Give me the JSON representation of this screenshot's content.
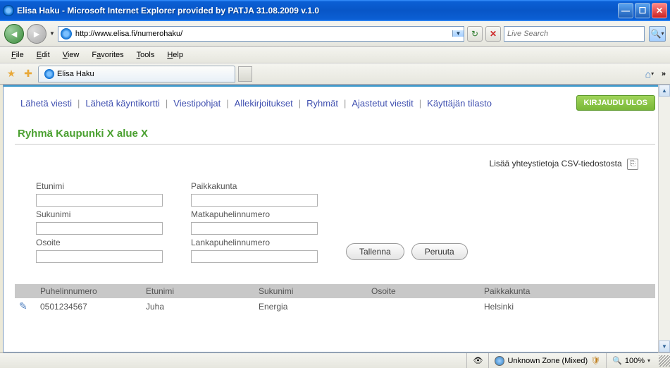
{
  "window": {
    "title": "Elisa Haku - Microsoft Internet Explorer provided by PATJA 31.08.2009 v.1.0"
  },
  "addressbar": {
    "url": "http://www.elisa.fi/numerohaku/"
  },
  "search": {
    "placeholder": "Live Search"
  },
  "menu": {
    "file": "File",
    "edit": "Edit",
    "view": "View",
    "favorites": "Favorites",
    "tools": "Tools",
    "help": "Help"
  },
  "tab": {
    "title": "Elisa Haku"
  },
  "appnav": {
    "items": [
      "Lähetä viesti",
      "Lähetä käyntikortti",
      "Viestipohjat",
      "Allekirjoitukset",
      "Ryhmät",
      "Ajastetut viestit",
      "Käyttäjän tilasto"
    ],
    "logout": "KIRJAUDU ULOS"
  },
  "page": {
    "title": "Ryhmä Kaupunki X alue X",
    "csv_link": "Lisää yhteystietoja CSV-tiedostosta"
  },
  "form": {
    "labels": {
      "etunimi": "Etunimi",
      "sukunimi": "Sukunimi",
      "osoite": "Osoite",
      "paikkakunta": "Paikkakunta",
      "matkapuhelin": "Matkapuhelinnumero",
      "lankapuhelin": "Lankapuhelinnumero"
    },
    "buttons": {
      "save": "Tallenna",
      "cancel": "Peruuta"
    }
  },
  "table": {
    "headers": {
      "phone": "Puhelinnumero",
      "firstname": "Etunimi",
      "lastname": "Sukunimi",
      "address": "Osoite",
      "city": "Paikkakunta"
    },
    "rows": [
      {
        "phone": "0501234567",
        "firstname": "Juha",
        "lastname": "Energia",
        "address": "",
        "city": "Helsinki"
      }
    ]
  },
  "status": {
    "zone": "Unknown Zone (Mixed)",
    "zoom": "100%"
  }
}
